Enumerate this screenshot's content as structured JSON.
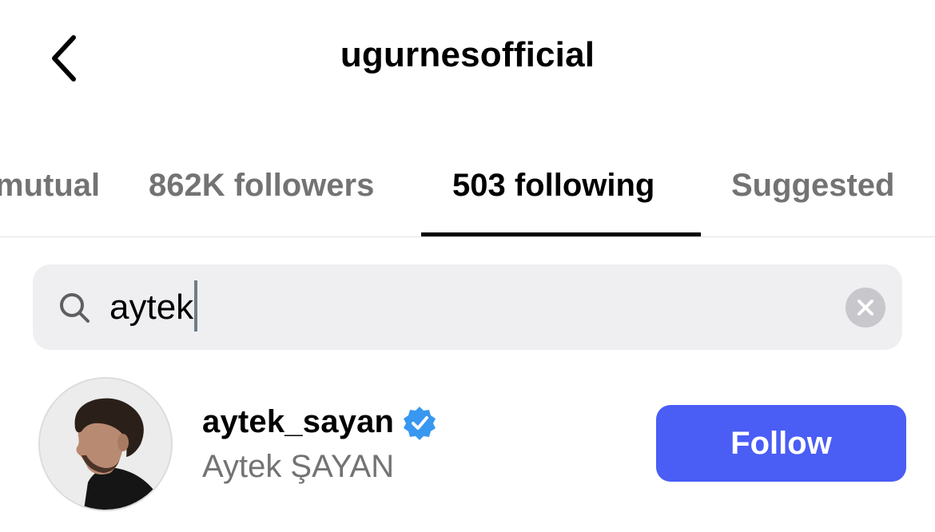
{
  "header": {
    "title": "ugurnesofficial",
    "back_icon": "chevron-left-icon"
  },
  "tabs": [
    {
      "label": "mutual",
      "active": false
    },
    {
      "label": "862K followers",
      "active": false
    },
    {
      "label": "503 following",
      "active": true
    },
    {
      "label": "Suggested",
      "active": false
    }
  ],
  "search": {
    "icon": "search-icon",
    "value": "aytek",
    "clear_icon": "clear-icon"
  },
  "results": [
    {
      "username": "aytek_sayan",
      "verified": true,
      "full_name": "Aytek ŞAYAN",
      "action_label": "Follow"
    }
  ],
  "colors": {
    "primary_button": "#4a5df5",
    "verified_badge": "#3897f0",
    "secondary_text": "#737373",
    "search_background": "#efeff2"
  }
}
